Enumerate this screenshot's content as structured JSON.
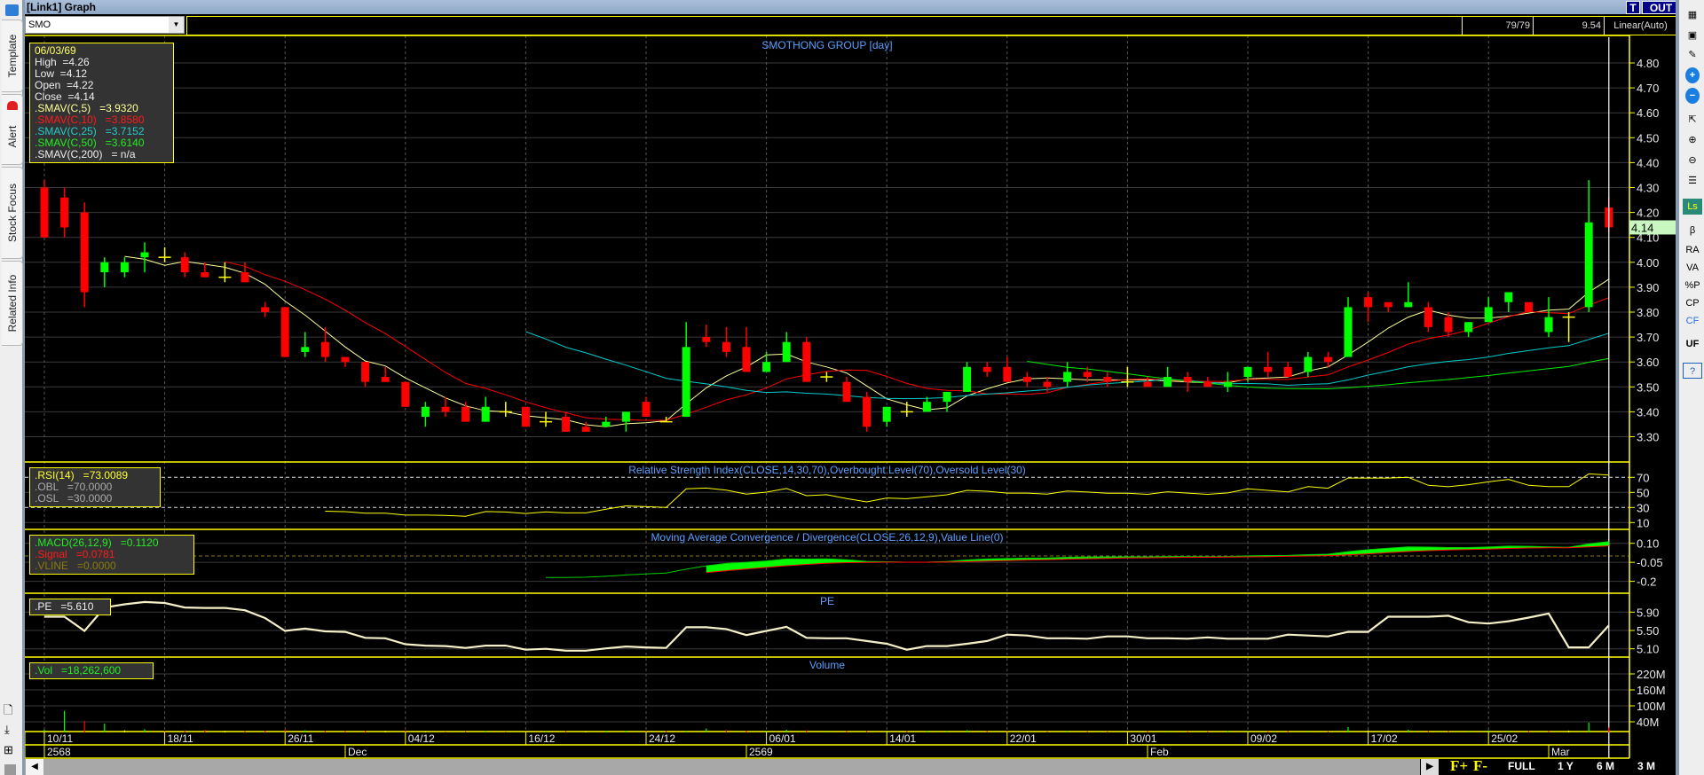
{
  "window": {
    "title": "[Link1] Graph",
    "t_button": "T",
    "out_button": "OUT"
  },
  "toolbar": {
    "symbol": "SMO",
    "bar_count": "79/79",
    "value": "9.54",
    "scale_mode": "Linear(Auto)"
  },
  "sidebar": {
    "tabs": [
      "Template",
      "Alert",
      "Stock Focus",
      "Related Info"
    ]
  },
  "right_toolbar": {
    "items": [
      {
        "icon": "table-icon",
        "label": "▦"
      },
      {
        "icon": "add-chart-icon",
        "label": "▣"
      },
      {
        "icon": "edit-icon",
        "label": "✎"
      },
      {
        "icon": "plus-icon",
        "label": "+"
      },
      {
        "icon": "minus-icon",
        "label": "−"
      },
      {
        "icon": "cursor-icon",
        "label": "⇱"
      },
      {
        "icon": "zoom-in-icon",
        "label": "⊕"
      },
      {
        "icon": "zoom-out-icon",
        "label": "⊖"
      },
      {
        "icon": "list-icon",
        "label": "☰"
      },
      {
        "icon": "ls-icon",
        "label": "Ls"
      },
      {
        "icon": "beta-icon",
        "label": "β"
      },
      {
        "icon": "ra-icon",
        "label": "RA"
      },
      {
        "icon": "va-icon",
        "label": "VA"
      },
      {
        "icon": "percent-p-icon",
        "label": "%P"
      },
      {
        "icon": "cp-icon",
        "label": "CP"
      },
      {
        "icon": "cf-icon",
        "label": "CF"
      },
      {
        "icon": "uf-icon",
        "label": "UF"
      },
      {
        "icon": "help-icon",
        "label": "?"
      }
    ]
  },
  "range_buttons": {
    "f_plus": "F+",
    "f_minus": "F-",
    "full": "FULL",
    "y1": "1 Y",
    "m6": "6 M",
    "m3": "3 M"
  },
  "legend": {
    "date": "06/03/69",
    "high": "High  =4.26",
    "low": "Low  =4.12",
    "open": "Open  =4.22",
    "close": "Close  =4.14",
    "sma5": ".SMAV(C,5)   =3.9320",
    "sma10": ".SMAV(C,10)   =3.8580",
    "sma25": ".SMAV(C,25)   =3.7152",
    "sma50": ".SMAV(C,50)   =3.6140",
    "sma200": ".SMAV(C,200)   = n/a",
    "rsi": ".RSI(14)   =73.0089",
    "obl": ".OBL   =70.0000",
    "osl": ".OSL   =30.0000",
    "macd": ".MACD(26,12,9)   =0.1120",
    "signal": ".Signal   =0.0781",
    "vline": ".VLINE   =0.0000",
    "pe": ".PE   =5.610",
    "vol": ".Vol   =18,262,600"
  },
  "colors": {
    "up": "#00ff00",
    "down": "#ff0000",
    "doji": "#ffff00",
    "sma5": "#ffff99",
    "sma10": "#ff0000",
    "sma25": "#00cccc",
    "sma50": "#00ee00",
    "frame": "#ffff00",
    "pe": "#f5f0c8",
    "title": "#5aa0ff",
    "last_price_bg": "#c8f7c0"
  },
  "chart_data": {
    "type": "candlestick",
    "title": "SMOTHONG GROUP [day]",
    "price_ticks": [
      "4.80",
      "4.70",
      "4.60",
      "4.50",
      "4.40",
      "4.30",
      "4.20",
      "4.10",
      "4.00",
      "3.90",
      "3.80",
      "3.70",
      "3.60",
      "3.50",
      "3.40",
      "3.30"
    ],
    "last_price": "4.14",
    "ohlc": [
      [
        4.3,
        4.33,
        4.1,
        4.1
      ],
      [
        4.26,
        4.3,
        4.1,
        4.14
      ],
      [
        4.2,
        4.24,
        3.82,
        3.88
      ],
      [
        3.96,
        4.02,
        3.9,
        4.0
      ],
      [
        3.96,
        4.02,
        3.94,
        4.0
      ],
      [
        4.02,
        4.08,
        3.96,
        4.04
      ],
      [
        4.02,
        4.06,
        4.0,
        4.02
      ],
      [
        4.02,
        4.04,
        3.94,
        3.96
      ],
      [
        3.96,
        4.0,
        3.94,
        3.94
      ],
      [
        3.94,
        4.0,
        3.92,
        3.94
      ],
      [
        3.96,
        4.0,
        3.92,
        3.92
      ],
      [
        3.82,
        3.84,
        3.78,
        3.8
      ],
      [
        3.82,
        3.82,
        3.62,
        3.62
      ],
      [
        3.64,
        3.72,
        3.62,
        3.66
      ],
      [
        3.68,
        3.74,
        3.6,
        3.62
      ],
      [
        3.62,
        3.62,
        3.58,
        3.6
      ],
      [
        3.6,
        3.6,
        3.5,
        3.52
      ],
      [
        3.54,
        3.58,
        3.52,
        3.52
      ],
      [
        3.52,
        3.52,
        3.42,
        3.42
      ],
      [
        3.38,
        3.44,
        3.34,
        3.42
      ],
      [
        3.42,
        3.46,
        3.38,
        3.4
      ],
      [
        3.42,
        3.44,
        3.36,
        3.36
      ],
      [
        3.36,
        3.46,
        3.36,
        3.42
      ],
      [
        3.4,
        3.44,
        3.38,
        3.4
      ],
      [
        3.42,
        3.42,
        3.34,
        3.34
      ],
      [
        3.36,
        3.4,
        3.34,
        3.36
      ],
      [
        3.38,
        3.4,
        3.32,
        3.32
      ],
      [
        3.34,
        3.36,
        3.32,
        3.32
      ],
      [
        3.34,
        3.38,
        3.34,
        3.36
      ],
      [
        3.36,
        3.4,
        3.32,
        3.4
      ],
      [
        3.44,
        3.46,
        3.38,
        3.38
      ],
      [
        3.36,
        3.38,
        3.36,
        3.36
      ],
      [
        3.38,
        3.76,
        3.38,
        3.66
      ],
      [
        3.7,
        3.75,
        3.66,
        3.68
      ],
      [
        3.68,
        3.74,
        3.62,
        3.64
      ],
      [
        3.66,
        3.74,
        3.56,
        3.56
      ],
      [
        3.56,
        3.64,
        3.56,
        3.6
      ],
      [
        3.6,
        3.72,
        3.6,
        3.68
      ],
      [
        3.68,
        3.7,
        3.52,
        3.52
      ],
      [
        3.54,
        3.56,
        3.52,
        3.54
      ],
      [
        3.52,
        3.54,
        3.44,
        3.44
      ],
      [
        3.46,
        3.48,
        3.32,
        3.34
      ],
      [
        3.36,
        3.42,
        3.34,
        3.42
      ],
      [
        3.4,
        3.44,
        3.38,
        3.4
      ],
      [
        3.4,
        3.46,
        3.4,
        3.44
      ],
      [
        3.44,
        3.48,
        3.4,
        3.48
      ],
      [
        3.48,
        3.6,
        3.48,
        3.58
      ],
      [
        3.58,
        3.6,
        3.54,
        3.56
      ],
      [
        3.58,
        3.62,
        3.52,
        3.52
      ],
      [
        3.54,
        3.56,
        3.5,
        3.52
      ],
      [
        3.52,
        3.54,
        3.48,
        3.5
      ],
      [
        3.52,
        3.6,
        3.5,
        3.56
      ],
      [
        3.56,
        3.58,
        3.52,
        3.54
      ],
      [
        3.54,
        3.56,
        3.5,
        3.52
      ],
      [
        3.52,
        3.58,
        3.5,
        3.52
      ],
      [
        3.52,
        3.54,
        3.5,
        3.5
      ],
      [
        3.5,
        3.58,
        3.5,
        3.54
      ],
      [
        3.54,
        3.56,
        3.48,
        3.52
      ],
      [
        3.52,
        3.54,
        3.5,
        3.5
      ],
      [
        3.5,
        3.56,
        3.48,
        3.52
      ],
      [
        3.54,
        3.58,
        3.52,
        3.58
      ],
      [
        3.58,
        3.64,
        3.54,
        3.56
      ],
      [
        3.58,
        3.6,
        3.54,
        3.54
      ],
      [
        3.56,
        3.64,
        3.54,
        3.62
      ],
      [
        3.62,
        3.64,
        3.58,
        3.6
      ],
      [
        3.62,
        3.86,
        3.62,
        3.82
      ],
      [
        3.86,
        3.88,
        3.76,
        3.82
      ],
      [
        3.84,
        3.84,
        3.8,
        3.82
      ],
      [
        3.82,
        3.92,
        3.82,
        3.84
      ],
      [
        3.82,
        3.84,
        3.72,
        3.74
      ],
      [
        3.78,
        3.8,
        3.7,
        3.72
      ],
      [
        3.72,
        3.76,
        3.7,
        3.76
      ],
      [
        3.76,
        3.86,
        3.76,
        3.82
      ],
      [
        3.84,
        3.88,
        3.8,
        3.88
      ],
      [
        3.84,
        3.84,
        3.8,
        3.8
      ],
      [
        3.72,
        3.86,
        3.7,
        3.78
      ],
      [
        3.78,
        3.8,
        3.68,
        3.78
      ],
      [
        3.82,
        4.33,
        3.8,
        4.16
      ],
      [
        4.22,
        4.26,
        4.12,
        4.14
      ]
    ],
    "sma_periods": [
      5,
      10,
      25,
      50
    ],
    "date_labels": [
      {
        "bar": 0,
        "text": "10/11"
      },
      {
        "bar": 6,
        "text": "18/11"
      },
      {
        "bar": 12,
        "text": "26/11"
      },
      {
        "bar": 18,
        "text": "04/12"
      },
      {
        "bar": 24,
        "text": "16/12"
      },
      {
        "bar": 30,
        "text": "24/12"
      },
      {
        "bar": 36,
        "text": "06/01"
      },
      {
        "bar": 42,
        "text": "14/01"
      },
      {
        "bar": 48,
        "text": "22/01"
      },
      {
        "bar": 54,
        "text": "30/01"
      },
      {
        "bar": 60,
        "text": "09/02"
      },
      {
        "bar": 66,
        "text": "17/02"
      },
      {
        "bar": 72,
        "text": "25/02"
      }
    ],
    "period_labels": [
      {
        "bar": 0,
        "text": "2568"
      },
      {
        "bar": 15,
        "text": "Dec"
      },
      {
        "bar": 35,
        "text": "2569"
      },
      {
        "bar": 55,
        "text": "Feb"
      },
      {
        "bar": 75,
        "text": "Mar"
      }
    ],
    "rsi": {
      "title": "Relative Strength Index(CLOSE,14,30,70),Overbought Level(70),Oversold Level(30)",
      "ticks": [
        "70",
        "50",
        "30",
        "10"
      ],
      "overbought": 70,
      "oversold": 30
    },
    "macd": {
      "title": "Moving Average Convergence / Divergence(CLOSE,26,12,9),Value Line(0)",
      "ticks": [
        "0.10",
        "-0.05",
        "-0.2"
      ]
    },
    "pe": {
      "title": "PE",
      "ticks": [
        "5.90",
        "5.50",
        "5.10"
      ],
      "values": [
        5.8,
        5.8,
        5.49,
        6.0,
        6.07,
        6.12,
        6.1,
        6.0,
        5.99,
        5.99,
        5.94,
        5.77,
        5.49,
        5.54,
        5.48,
        5.47,
        5.34,
        5.33,
        5.2,
        5.17,
        5.16,
        5.12,
        5.17,
        5.17,
        5.08,
        5.1,
        5.06,
        5.06,
        5.11,
        5.15,
        5.13,
        5.12,
        5.57,
        5.57,
        5.53,
        5.4,
        5.49,
        5.58,
        5.34,
        5.33,
        5.33,
        5.27,
        5.21,
        5.08,
        5.16,
        5.16,
        5.21,
        5.27,
        5.41,
        5.39,
        5.33,
        5.33,
        5.32,
        5.37,
        5.37,
        5.33,
        5.33,
        5.32,
        5.35,
        5.32,
        5.32,
        5.32,
        5.41,
        5.39,
        5.37,
        5.47,
        5.47,
        5.8,
        5.8,
        5.8,
        5.82,
        5.68,
        5.65,
        5.7,
        5.78,
        5.87,
        5.13,
        5.13,
        5.61
      ]
    },
    "volume": {
      "title": "Volume",
      "ticks": [
        "220M",
        "160M",
        "100M",
        "40M"
      ],
      "values_millions": [
        10,
        81,
        44,
        33,
        8,
        12,
        6,
        8,
        10,
        6,
        5,
        7,
        12,
        8,
        6,
        5,
        7,
        6,
        8,
        5,
        3,
        4,
        5,
        3,
        4,
        4,
        5,
        5,
        6,
        6,
        7,
        5,
        4,
        15,
        9,
        7,
        6,
        10,
        8,
        3,
        5,
        5,
        3,
        5,
        6,
        4,
        8,
        5,
        5,
        3,
        4,
        4,
        4,
        4,
        5,
        5,
        3,
        4,
        4,
        5,
        5,
        4,
        5,
        3,
        4,
        20,
        8,
        5,
        10,
        5,
        5,
        4,
        8,
        4,
        5,
        5,
        7,
        37,
        18.26
      ]
    }
  }
}
